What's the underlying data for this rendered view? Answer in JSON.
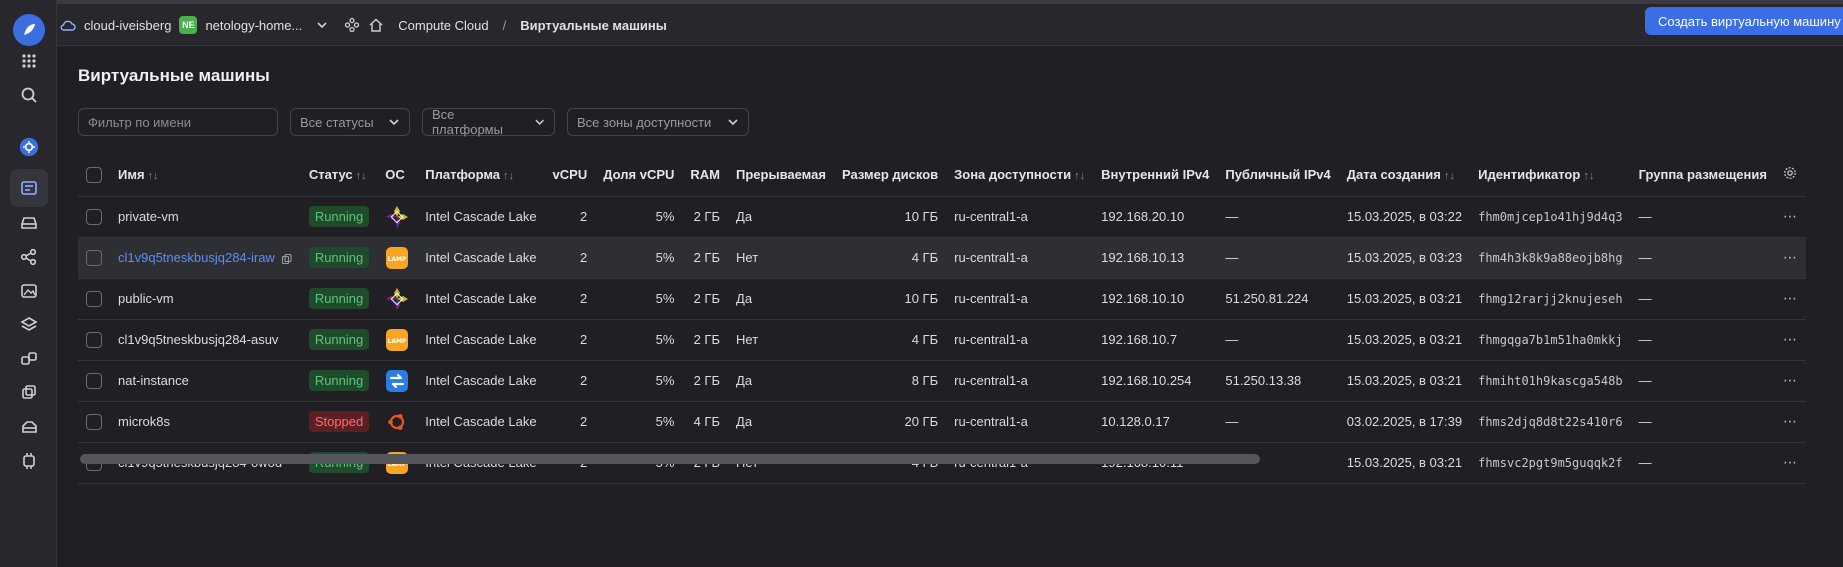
{
  "topbar": {
    "cloud_name": "cloud-iveisberg",
    "folder_badge": "NE",
    "folder_name": "netology-home...",
    "service": "Compute Cloud",
    "separator": "/",
    "current_page": "Виртуальные машины",
    "create_button": "Создать виртуальную машину"
  },
  "page": {
    "title": "Виртуальные машины",
    "filter_placeholder": "Фильтр по имени",
    "status_select": "Все статусы",
    "platform_select": "Все платформы",
    "zone_select": "Все зоны доступности"
  },
  "table": {
    "headers": {
      "name": "Имя",
      "status": "Статус",
      "os": "ОС",
      "platform": "Платформа",
      "vcpu": "vCPU",
      "vcpu_share": "Доля vCPU",
      "ram": "RAM",
      "preemptible": "Прерываемая",
      "disk_size": "Размер дисков",
      "zone": "Зона доступности",
      "internal_ip": "Внутренний IPv4",
      "public_ip": "Публичный IPv4",
      "created": "Дата создания",
      "id": "Идентификатор",
      "placement": "Группа размещения"
    },
    "sort_glyph": "↑↓",
    "menu_glyph": "⋯",
    "rows": [
      {
        "name": "private-vm",
        "status": "Running",
        "os": "centos",
        "platform": "Intel Cascade Lake",
        "vcpu": "2",
        "share": "5%",
        "ram": "2 ГБ",
        "preemptible": "Да",
        "disk": "10 ГБ",
        "zone": "ru-central1-a",
        "internal_ip": "192.168.20.10",
        "public_ip": "—",
        "created": "15.03.2025, в 03:22",
        "id": "fhm0mjcep1o41hj9d4q3",
        "placement": "—"
      },
      {
        "name": "cl1v9q5tneskbusjq284-iraw",
        "status": "Running",
        "os": "lamp",
        "platform": "Intel Cascade Lake",
        "vcpu": "2",
        "share": "5%",
        "ram": "2 ГБ",
        "preemptible": "Нет",
        "disk": "4 ГБ",
        "zone": "ru-central1-a",
        "internal_ip": "192.168.10.13",
        "public_ip": "—",
        "created": "15.03.2025, в 03:23",
        "id": "fhm4h3k8k9a88eojb8hg",
        "placement": "—"
      },
      {
        "name": "public-vm",
        "status": "Running",
        "os": "centos",
        "platform": "Intel Cascade Lake",
        "vcpu": "2",
        "share": "5%",
        "ram": "2 ГБ",
        "preemptible": "Да",
        "disk": "10 ГБ",
        "zone": "ru-central1-a",
        "internal_ip": "192.168.10.10",
        "public_ip": "51.250.81.224",
        "created": "15.03.2025, в 03:21",
        "id": "fhmg12rarjj2knujeseh",
        "placement": "—"
      },
      {
        "name": "cl1v9q5tneskbusjq284-asuv",
        "status": "Running",
        "os": "lamp",
        "platform": "Intel Cascade Lake",
        "vcpu": "2",
        "share": "5%",
        "ram": "2 ГБ",
        "preemptible": "Нет",
        "disk": "4 ГБ",
        "zone": "ru-central1-a",
        "internal_ip": "192.168.10.7",
        "public_ip": "—",
        "created": "15.03.2025, в 03:21",
        "id": "fhmgqga7b1m51ha0mkkj",
        "placement": "—"
      },
      {
        "name": "nat-instance",
        "status": "Running",
        "os": "nat",
        "platform": "Intel Cascade Lake",
        "vcpu": "2",
        "share": "5%",
        "ram": "2 ГБ",
        "preemptible": "Да",
        "disk": "8 ГБ",
        "zone": "ru-central1-a",
        "internal_ip": "192.168.10.254",
        "public_ip": "51.250.13.38",
        "created": "15.03.2025, в 03:21",
        "id": "fhmiht01h9kascga548b",
        "placement": "—"
      },
      {
        "name": "microk8s",
        "status": "Stopped",
        "os": "ubuntu",
        "platform": "Intel Cascade Lake",
        "vcpu": "2",
        "share": "5%",
        "ram": "4 ГБ",
        "preemptible": "Да",
        "disk": "20 ГБ",
        "zone": "ru-central1-a",
        "internal_ip": "10.128.0.17",
        "public_ip": "—",
        "created": "03.02.2025, в 17:39",
        "id": "fhms2djq8d8t22s410r6",
        "placement": "—"
      },
      {
        "name": "cl1v9q5tneskbusjq284-owod",
        "status": "Running",
        "os": "lamp",
        "platform": "Intel Cascade Lake",
        "vcpu": "2",
        "share": "5%",
        "ram": "2 ГБ",
        "preemptible": "Нет",
        "disk": "4 ГБ",
        "zone": "ru-central1-a",
        "internal_ip": "192.168.10.11",
        "public_ip": "—",
        "created": "15.03.2025, в 03:21",
        "id": "fhmsvc2pgt9m5guqqk2f",
        "placement": "—"
      }
    ]
  },
  "colors": {
    "accent": "#3a6de6",
    "running_bg": "#1f4a2c",
    "running_fg": "#5fc27a",
    "stopped_bg": "#5c1f24",
    "stopped_fg": "#ff6b74",
    "link": "#5b8ef6"
  }
}
